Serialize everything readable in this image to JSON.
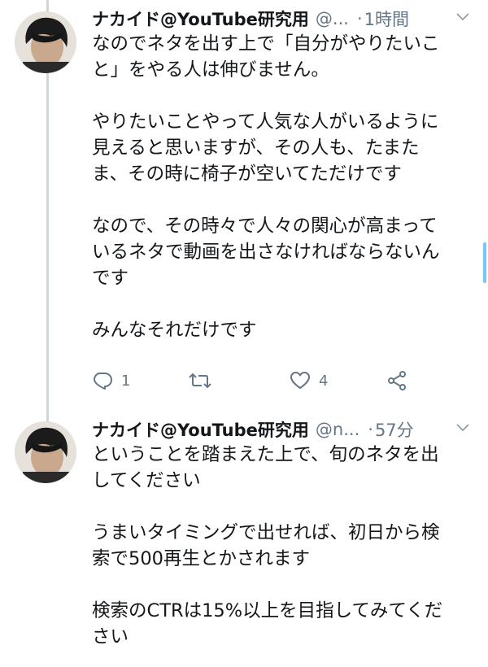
{
  "tweets": [
    {
      "display_name": "ナカイド@YouTube研究用",
      "handle": "@...",
      "separator": "·",
      "time": "1時間",
      "paragraphs": [
        [
          "なのでネタを出す上で「自分がやりたいこ",
          "と」をやる人は伸びません。"
        ],
        [
          "やりたいことやって人気な人がいるように",
          "見えると思いますが、その人も、たまた",
          "ま、その時に椅子が空いてただけです"
        ],
        [
          "なので、その時々で人々の関心が高まって",
          "いるネタで動画を出さなければならないん",
          "です"
        ],
        [
          "みんなそれだけです"
        ]
      ],
      "reply_count": "1",
      "like_count": "4"
    },
    {
      "display_name": "ナカイド@YouTube研究用",
      "handle": "@n...",
      "separator": "·",
      "time": "57分",
      "paragraphs": [
        [
          "ということを踏まえた上で、旬のネタを出",
          "してください"
        ],
        [
          "うまいタイミングで出せれば、初日から検",
          "索で500再生とかされます"
        ],
        [
          "検索のCTRは15%以上を目指してみてくだ",
          "さい"
        ]
      ]
    }
  ],
  "icons": {
    "reply": "reply-icon",
    "retweet": "retweet-icon",
    "like": "heart-icon",
    "share": "share-icon",
    "more": "chevron-down-icon"
  },
  "colors": {
    "text": "#14171a",
    "secondary": "#657786",
    "thread_line": "#ccd6dd",
    "scroll": "#1da1f2"
  }
}
